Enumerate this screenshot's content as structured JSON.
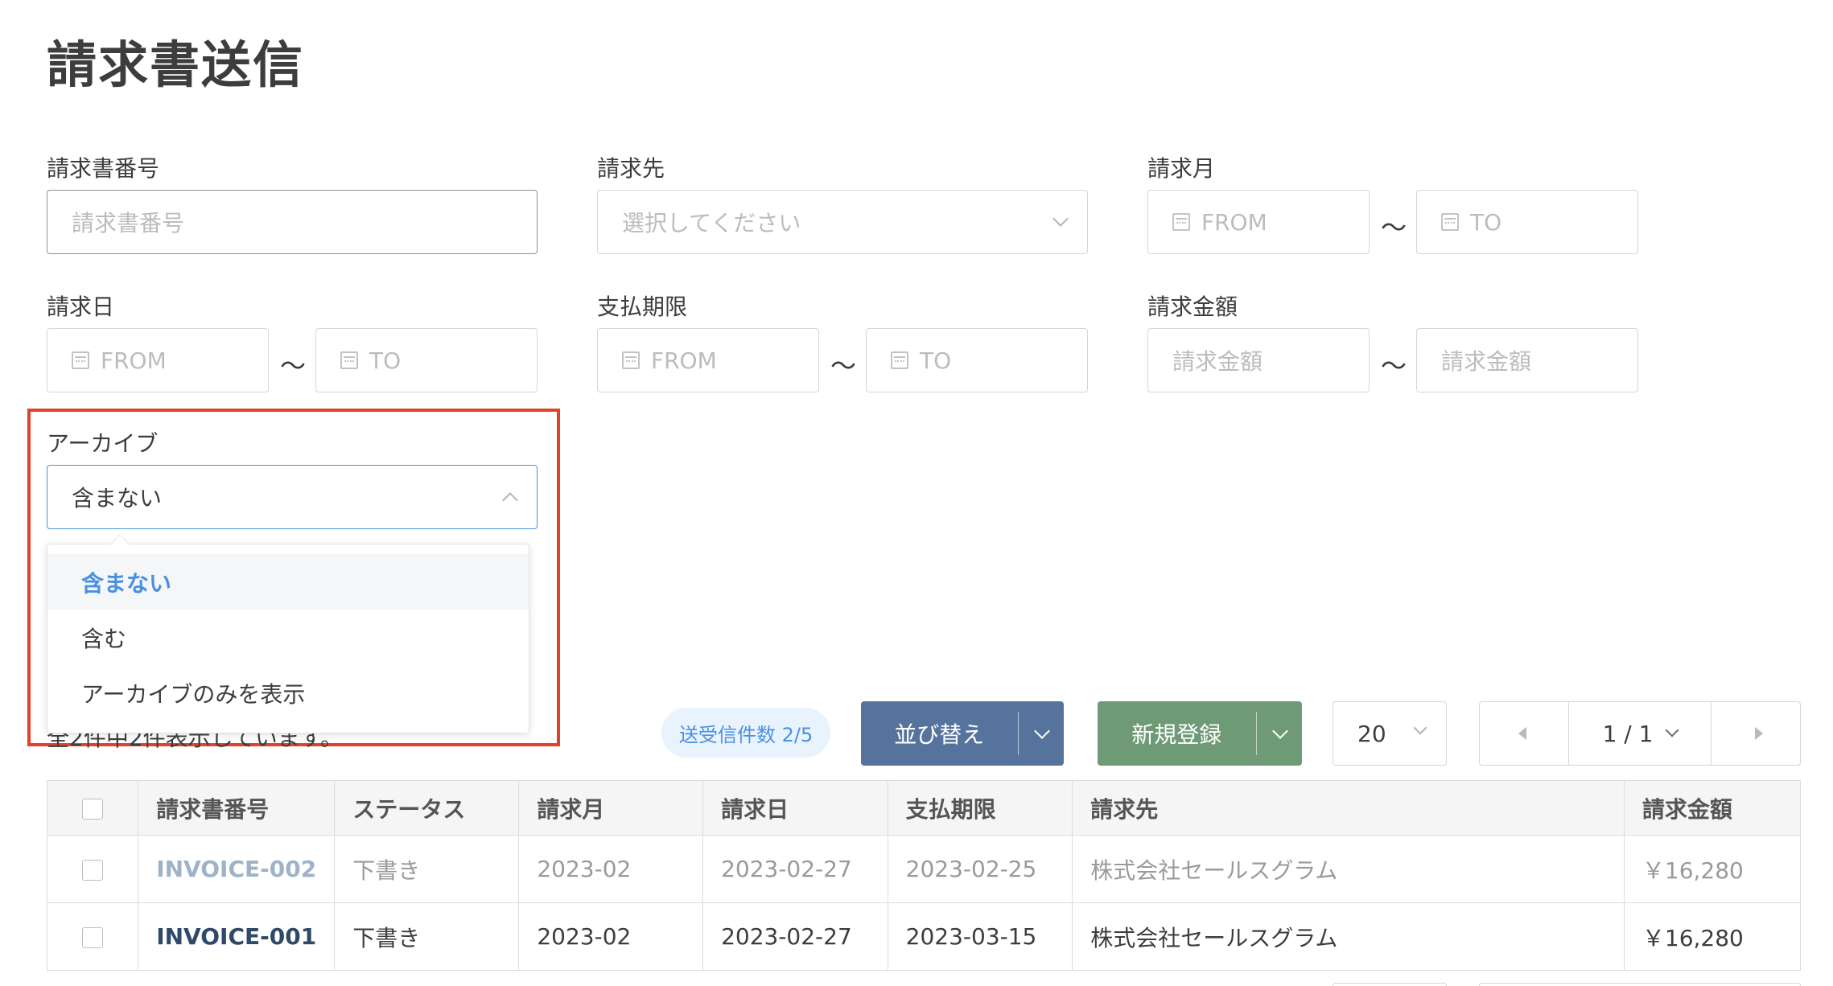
{
  "page": {
    "title": "請求書送信"
  },
  "filters": {
    "invoice_no": {
      "label": "請求書番号",
      "placeholder": "請求書番号"
    },
    "recipient": {
      "label": "請求先",
      "placeholder": "選択してください"
    },
    "billing_month": {
      "label": "請求月",
      "from": "FROM",
      "to": "TO"
    },
    "billing_date": {
      "label": "請求日",
      "from": "FROM",
      "to": "TO"
    },
    "due_date": {
      "label": "支払期限",
      "from": "FROM",
      "to": "TO"
    },
    "amount": {
      "label": "請求金額",
      "from_placeholder": "請求金額",
      "to_placeholder": "請求金額"
    },
    "archive": {
      "label": "アーカイブ",
      "value": "含まない",
      "options": [
        "含まない",
        "含む",
        "アーカイブのみを表示"
      ]
    },
    "range_separator": "〜"
  },
  "toolbar": {
    "count_text": "全2件中2件表示しています。",
    "sent_badge": "送受信件数 2/5",
    "sort_label": "並び替え",
    "new_label": "新規登録",
    "per_page": "20",
    "page_indicator": "1 / 1"
  },
  "table": {
    "headers": [
      "請求書番号",
      "ステータス",
      "請求月",
      "請求日",
      "支払期限",
      "請求先",
      "請求金額"
    ],
    "rows": [
      {
        "invoice_no": "INVOICE-002",
        "status": "下書き",
        "month": "2023-02",
        "date": "2023-02-27",
        "due": "2023-02-25",
        "recipient": "株式会社セールスグラム",
        "amount": "￥16,280"
      },
      {
        "invoice_no": "INVOICE-001",
        "status": "下書き",
        "month": "2023-02",
        "date": "2023-02-27",
        "due": "2023-03-15",
        "recipient": "株式会社セールスグラム",
        "amount": "￥16,280"
      }
    ]
  },
  "colors": {
    "accent": "#4a90e2",
    "sort_button": "#55739c",
    "new_button": "#6f9a76",
    "highlight_box": "#e0412c"
  }
}
